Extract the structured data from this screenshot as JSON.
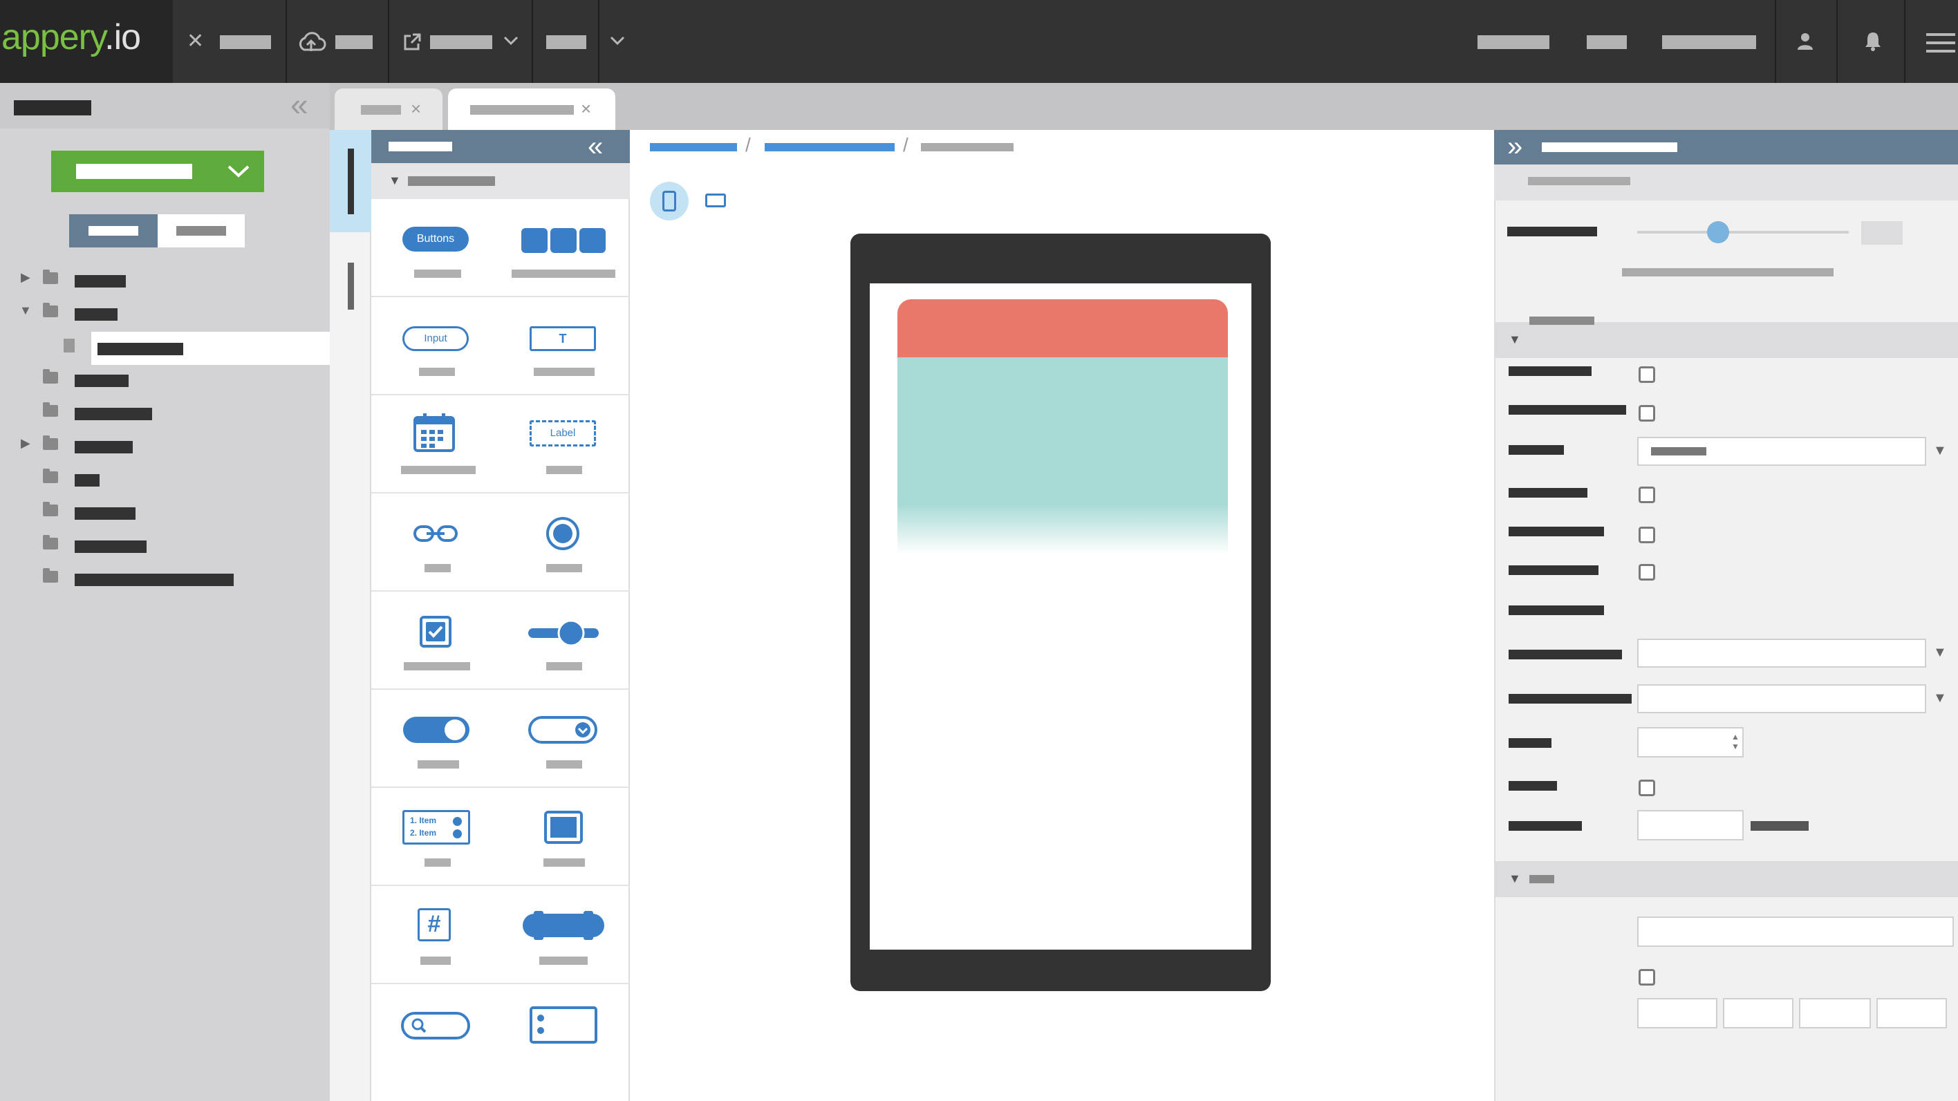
{
  "app": {
    "logo_part1": "appery",
    "logo_part2": ".io"
  },
  "palette": {
    "buttons_label": "Buttons",
    "input_label": "Input",
    "text_label": "T",
    "label_label": "Label",
    "list_item1": "1. Item",
    "list_item2": "2. Item",
    "hash_symbol": "#"
  },
  "icons": {
    "close": "close-icon",
    "cloud": "cloud-upload-icon",
    "export": "external-link-icon",
    "chevron": "chevron-down-icon",
    "user": "user-icon",
    "bell": "bell-icon",
    "menu": "hamburger-menu-icon",
    "collapse": "double-chevron-left-icon",
    "expand": "double-chevron-right-icon"
  },
  "colors": {
    "brand_green": "#7ac143",
    "create_button": "#5eab3c",
    "panel_header": "#647d93",
    "accent_blue": "#3a7fc5",
    "phone_header": "#e8796a",
    "phone_body": "#a9dbd6"
  }
}
